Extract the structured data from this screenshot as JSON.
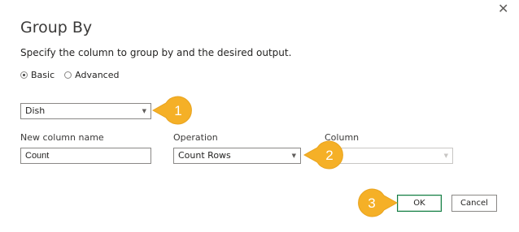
{
  "dialog": {
    "close_glyph": "✕",
    "title": "Group By",
    "subtitle": "Specify the column to group by and the desired output."
  },
  "mode": {
    "options": [
      "Basic",
      "Advanced"
    ],
    "selected": "Basic"
  },
  "group_column": {
    "value": "Dish"
  },
  "new_column": {
    "label": "New column name",
    "value": "Count"
  },
  "operation": {
    "label": "Operation",
    "value": "Count Rows"
  },
  "column": {
    "label": "Column",
    "value": ""
  },
  "buttons": {
    "ok": "OK",
    "cancel": "Cancel"
  },
  "callouts": [
    "1",
    "2",
    "3"
  ],
  "colors": {
    "callout_fill": "#f5b027",
    "callout_edge": "#e8a31e",
    "ok_border": "#107c41"
  }
}
